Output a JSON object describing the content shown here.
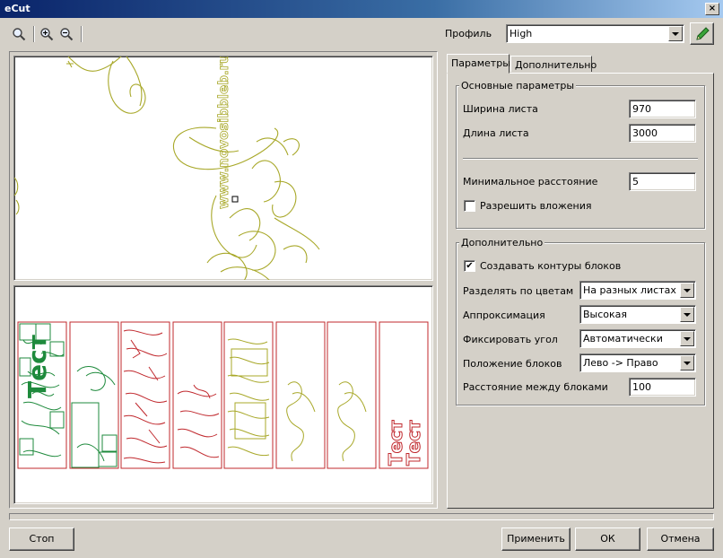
{
  "window": {
    "title": "eCut",
    "close_glyph": "×"
  },
  "toolbar": {
    "profile_label": "Профиль",
    "profile_value": "High"
  },
  "tabs": [
    {
      "label": "Параметры",
      "active": true
    },
    {
      "label": "Дополнительно",
      "active": false
    }
  ],
  "basic": {
    "legend": "Основные параметры",
    "sheet_width_label": "Ширина листа",
    "sheet_width_value": "970",
    "sheet_length_label": "Длина листа",
    "sheet_length_value": "3000",
    "min_distance_label": "Минимальное расстояние",
    "min_distance_value": "5",
    "allow_nesting_label": "Разрешить вложения",
    "allow_nesting_checked": false
  },
  "extra": {
    "legend": "Дополнительно",
    "create_contours_label": "Создавать контуры блоков",
    "create_contours_checked": true,
    "split_colors_label": "Разделять по цветам",
    "split_colors_value": "На разных листах",
    "approximation_label": "Аппроксимация",
    "approximation_value": "Высокая",
    "fix_angle_label": "Фиксировать угол",
    "fix_angle_value": "Автоматически",
    "block_position_label": "Положение блоков",
    "block_position_value": "Лево -> Право",
    "block_distance_label": "Расстояние между блоками",
    "block_distance_value": "100"
  },
  "preview": {
    "url_text": "www.novosibbleb.ru",
    "test_text": "Тест",
    "check_mark": "✔"
  },
  "buttons": {
    "stop": "Стоп",
    "apply": "Применить",
    "ok": "ОК",
    "cancel": "Отмена"
  },
  "colors": {
    "olive": "#a8a829",
    "red": "#c0282d",
    "green": "#1e8a3c",
    "block_outline": "#c0282d"
  }
}
